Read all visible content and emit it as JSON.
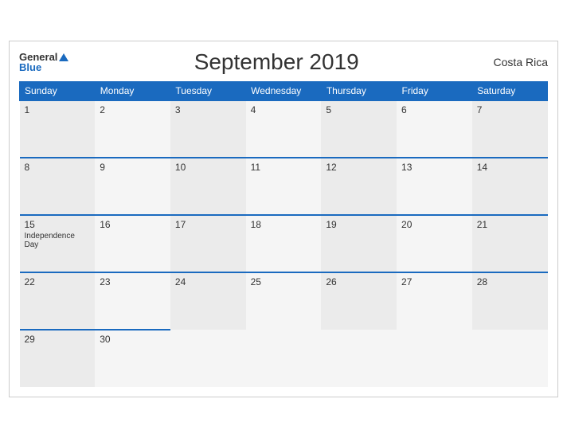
{
  "header": {
    "logo_general": "General",
    "logo_blue": "Blue",
    "title": "September 2019",
    "country": "Costa Rica"
  },
  "days_of_week": [
    "Sunday",
    "Monday",
    "Tuesday",
    "Wednesday",
    "Thursday",
    "Friday",
    "Saturday"
  ],
  "weeks": [
    [
      {
        "day": "1",
        "event": ""
      },
      {
        "day": "2",
        "event": ""
      },
      {
        "day": "3",
        "event": ""
      },
      {
        "day": "4",
        "event": ""
      },
      {
        "day": "5",
        "event": ""
      },
      {
        "day": "6",
        "event": ""
      },
      {
        "day": "7",
        "event": ""
      }
    ],
    [
      {
        "day": "8",
        "event": ""
      },
      {
        "day": "9",
        "event": ""
      },
      {
        "day": "10",
        "event": ""
      },
      {
        "day": "11",
        "event": ""
      },
      {
        "day": "12",
        "event": ""
      },
      {
        "day": "13",
        "event": ""
      },
      {
        "day": "14",
        "event": ""
      }
    ],
    [
      {
        "day": "15",
        "event": "Independence Day"
      },
      {
        "day": "16",
        "event": ""
      },
      {
        "day": "17",
        "event": ""
      },
      {
        "day": "18",
        "event": ""
      },
      {
        "day": "19",
        "event": ""
      },
      {
        "day": "20",
        "event": ""
      },
      {
        "day": "21",
        "event": ""
      }
    ],
    [
      {
        "day": "22",
        "event": ""
      },
      {
        "day": "23",
        "event": ""
      },
      {
        "day": "24",
        "event": ""
      },
      {
        "day": "25",
        "event": ""
      },
      {
        "day": "26",
        "event": ""
      },
      {
        "day": "27",
        "event": ""
      },
      {
        "day": "28",
        "event": ""
      }
    ],
    [
      {
        "day": "29",
        "event": ""
      },
      {
        "day": "30",
        "event": ""
      },
      {
        "day": "",
        "event": ""
      },
      {
        "day": "",
        "event": ""
      },
      {
        "day": "",
        "event": ""
      },
      {
        "day": "",
        "event": ""
      },
      {
        "day": "",
        "event": ""
      }
    ]
  ]
}
